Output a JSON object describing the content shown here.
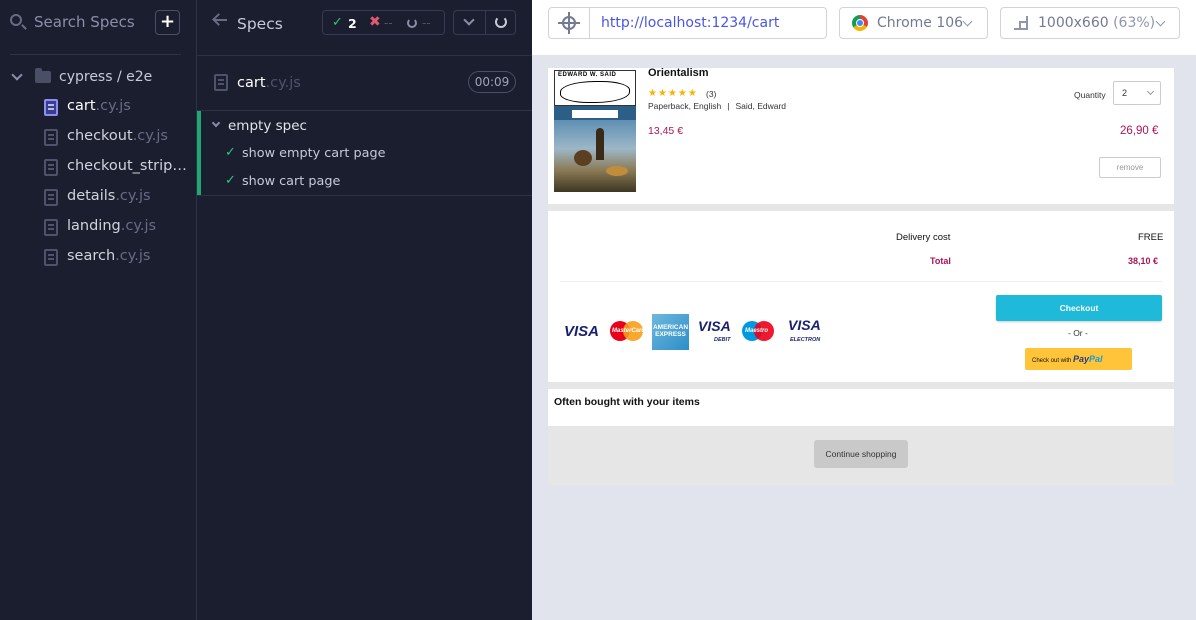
{
  "specs_panel": {
    "search_label": "Search Specs",
    "add_label": "+",
    "folder": "cypress / e2e",
    "items": [
      {
        "name": "cart",
        "ext": ".cy.js",
        "active": true
      },
      {
        "name": "checkout",
        "ext": ".cy.js"
      },
      {
        "name": "checkout_stripe",
        "ext": "..."
      },
      {
        "name": "details",
        "ext": ".cy.js"
      },
      {
        "name": "landing",
        "ext": ".cy.js"
      },
      {
        "name": "search",
        "ext": ".cy.js"
      }
    ]
  },
  "runner": {
    "title": "Specs",
    "stats": {
      "passed": "2",
      "failed": "--",
      "pending": "--"
    },
    "file": {
      "name": "cart",
      "ext": ".cy.js"
    },
    "duration": "00:09",
    "suite": "empty spec",
    "tests": [
      "show empty cart page",
      "show cart page"
    ]
  },
  "toolbar": {
    "url": "http://localhost:1234/cart",
    "browser": "Chrome 106",
    "viewport": "1000x660",
    "viewport_scale": "(63%)"
  },
  "aut": {
    "product": {
      "title": "Orientalism",
      "cover_author": "EDWARD W. SAID",
      "stars": "★★★★★",
      "rating_count": "(3)",
      "format": "Paperback, English",
      "author": "Said, Edward",
      "unit_price": "13,45 €",
      "quantity_label": "Quantity",
      "quantity": "2",
      "line_price": "26,90 €",
      "remove_label": "remove"
    },
    "summary": {
      "delivery_label": "Delivery cost",
      "delivery_value": "FREE",
      "total_label": "Total",
      "total_value": "38,10 €",
      "checkout_label": "Checkout",
      "or_label": "- Or -",
      "paypal_prefix": "Check out with",
      "paypal_logo_pay": "Pay",
      "paypal_logo_pal": "Pal"
    },
    "payment_logos": {
      "visa": "VISA",
      "mastercard": "MasterCard",
      "amex": "AMERICAN EXPRESS",
      "visa_debit": "VISA",
      "debit_sub": "DEBIT",
      "maestro": "Maestro",
      "visa_electron": "VISA",
      "electron_sub": "ELECTRON"
    },
    "often_bought_title": "Often bought with your items",
    "continue_label": "Continue shopping"
  },
  "colors": {
    "runner_bg": "#1b1e2e",
    "pass": "#2fc77a",
    "fail": "#e45770",
    "accent": "#4956e3",
    "price": "#ad1457",
    "checkout": "#1fb9d9",
    "paypal": "#ffc439"
  }
}
